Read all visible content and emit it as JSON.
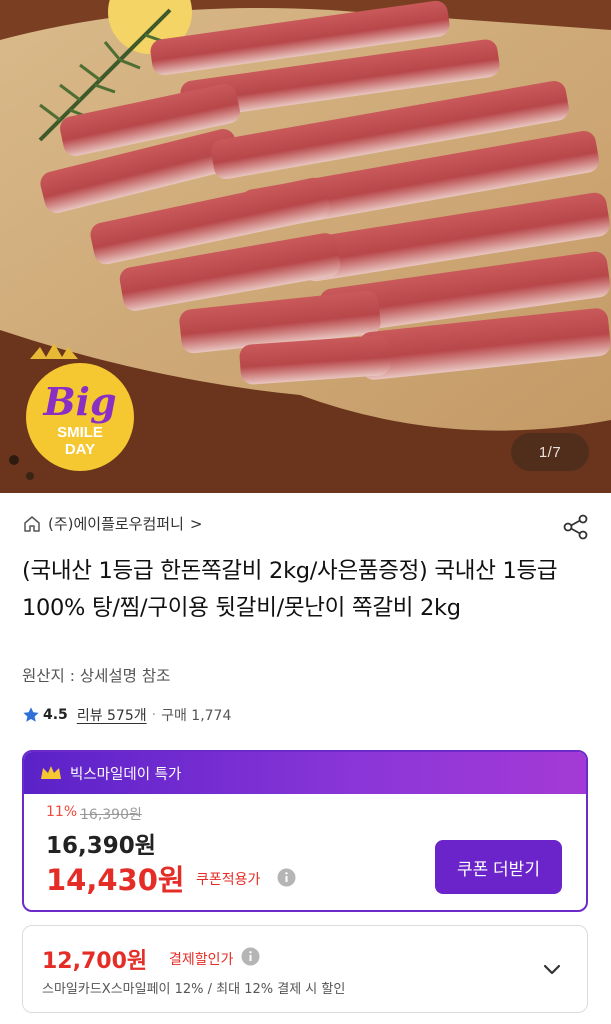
{
  "gallery": {
    "counter": "1/7",
    "badge_big": "Big",
    "badge_line1": "SMILE",
    "badge_line2": "DAY"
  },
  "seller": {
    "name": "(주)에이플로우컴퍼니",
    "chevron": ">"
  },
  "product": {
    "title": "(국내산 1등급 한돈쪽갈비 2kg/사은품증정) 국내산 1등급 100% 탕/찜/구이용 뒷갈비/못난이 쪽갈비 2kg",
    "origin": "원산지 : 상세설명 참조",
    "rating": "4.5",
    "reviews": "리뷰 575개",
    "separator": "·",
    "purchases": "구매 1,774"
  },
  "deal": {
    "header": "빅스마일데이 특가",
    "discount_pct": "11%",
    "original_price": "16,390원",
    "price": "16,390원",
    "coupon_price": "14,430원",
    "coupon_label": "쿠폰적용가",
    "coupon_button": "쿠폰 더받기"
  },
  "payment": {
    "price": "12,700원",
    "label": "결제할인가",
    "description": "스마일카드X스마일페이 12% / 최대 12% 결제 시 할인"
  },
  "colors": {
    "accent_purple": "#6a24c9",
    "sale_red": "#e52d27",
    "star_blue": "#2f6fd8"
  },
  "icons": [
    "home-icon",
    "share-icon",
    "star-icon",
    "crown-icon",
    "info-icon",
    "chevron-down-icon"
  ]
}
